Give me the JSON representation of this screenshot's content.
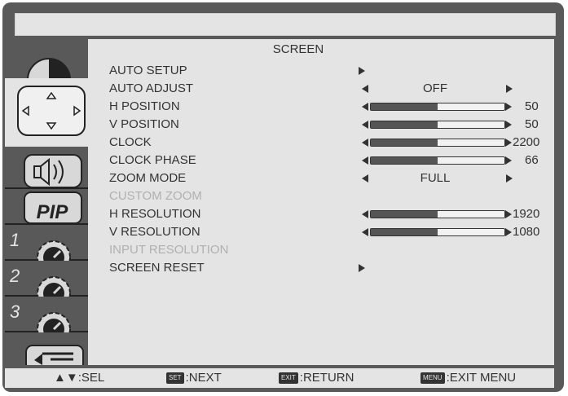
{
  "screen": {
    "title": "SCREEN"
  },
  "menu": [
    {
      "label": "AUTO SETUP",
      "type": "action"
    },
    {
      "label": "AUTO ADJUST",
      "type": "choice",
      "value": "OFF"
    },
    {
      "label": "H POSITION",
      "type": "slider",
      "value": "50",
      "level": 0.5
    },
    {
      "label": "V POSITION",
      "type": "slider",
      "value": "50",
      "level": 0.5
    },
    {
      "label": "CLOCK",
      "type": "slider",
      "value": "2200",
      "level": 0.5
    },
    {
      "label": "CLOCK PHASE",
      "type": "slider",
      "value": "66",
      "level": 0.5
    },
    {
      "label": "ZOOM MODE",
      "type": "choice",
      "value": "FULL"
    },
    {
      "label": "CUSTOM ZOOM",
      "type": "disabled"
    },
    {
      "label": "H RESOLUTION",
      "type": "slider",
      "value": "1920",
      "level": 0.5
    },
    {
      "label": "V RESOLUTION",
      "type": "slider",
      "value": "1080",
      "level": 0.5
    },
    {
      "label": "INPUT RESOLUTION",
      "type": "disabled"
    },
    {
      "label": "SCREEN RESET",
      "type": "action"
    }
  ],
  "tabs": [
    {
      "icon": "picture-icon"
    },
    {
      "icon": "screen-position-icon"
    },
    {
      "icon": "audio-icon"
    },
    {
      "icon": "pip-icon",
      "text": "PIP"
    },
    {
      "icon": "schedule-1-icon",
      "num": "1"
    },
    {
      "icon": "schedule-2-icon",
      "num": "2"
    },
    {
      "icon": "schedule-3-icon",
      "num": "3"
    },
    {
      "icon": "advanced-option-icon"
    }
  ],
  "footer": {
    "sel_label": "SEL",
    "set_key": "SET",
    "next_label": ":NEXT",
    "exit_key": "EXIT",
    "return_label": ":RETURN",
    "menu_key": "MENU",
    "exit_menu_label": ":EXIT MENU"
  },
  "colors": {
    "frame": "#595959",
    "panel": "#e4e4e4",
    "text": "#333333",
    "disabled": "#b0b0b0"
  }
}
